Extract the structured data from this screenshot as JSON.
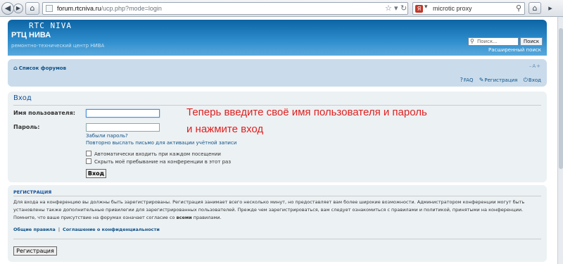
{
  "browser": {
    "url_domain": "forum.rtcniva.ru",
    "url_path": "/ucp.php?mode=login",
    "search_value": "microtic proxy",
    "search_engine_glyph": "Я"
  },
  "header": {
    "overlay_title": "RTC NIVA",
    "site_name": "РТЦ НИВА",
    "site_description": "ремонтно-технический центр НИВА",
    "search_placeholder": "Поиск...",
    "search_button": "Поиск",
    "advanced_search": "Расширенный поиск"
  },
  "navbar": {
    "forum_index": "Список форумов",
    "font_size_control": "–A+",
    "links": [
      "FAQ",
      "Регистрация",
      "Вход"
    ]
  },
  "login": {
    "title": "Вход",
    "username_label": "Имя пользователя:",
    "password_label": "Пароль:",
    "forgot_password": "Забыли пароль?",
    "resend_activation": "Повторно выслать письмо для активации учётной записи",
    "autologin_label": "Автоматически входить при каждом посещении",
    "hide_online_label": "Скрыть моё пребывание на конференции в этот раз",
    "login_button": "Вход",
    "annotation_line1": "Теперь введите своё имя пользователя и пароль",
    "annotation_line2": "и нажмите вход"
  },
  "registration": {
    "title": "РЕГИСТРАЦИЯ",
    "text_line1": "Для входа на конференцию вы должны быть зарегистрированы. Регистрация занимает всего несколько минут, но предоставляет вам более широкие возможности. Администратором конференции могут быть",
    "text_line2": "установлены также дополнительные привилегии для зарегистрированных пользователей. Прежде чем зарегистрироваться, вам следует ознакомиться с правилами и политикой, принятыми на конференции.",
    "text_line3_a": "Помните, что ваше присутствие на форумах означает согласие со ",
    "text_line3_b": "всеми",
    "text_line3_c": " правилами.",
    "terms_link": "Общие правила",
    "privacy_link": "Соглашение о конфиденциальности",
    "register_button": "Регистрация"
  },
  "colors": {
    "header_gradient_top": "#0c64a4",
    "nav_bg": "#cadceb",
    "panel_bg": "#ecf1f3",
    "link": "#105289",
    "annotation": "#e02020"
  }
}
